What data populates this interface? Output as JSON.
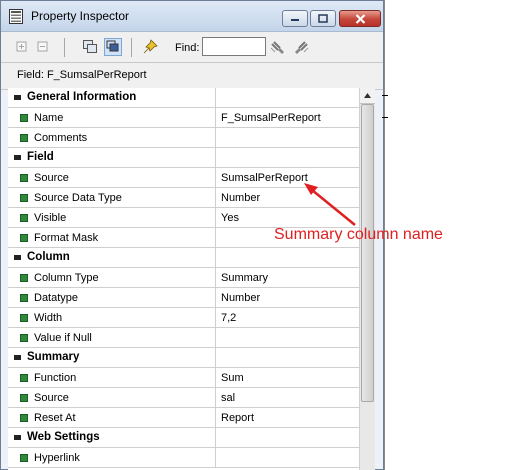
{
  "window": {
    "title": "Property Inspector"
  },
  "toolbar": {
    "find_label": "Find:",
    "find_value": ""
  },
  "field_bar": {
    "text": "Field: F_SumsalPerReport"
  },
  "sections": [
    {
      "label": "General Information",
      "rows": [
        {
          "label": "Name",
          "value": "F_SumsalPerReport"
        },
        {
          "label": "Comments",
          "value": ""
        }
      ]
    },
    {
      "label": "Field",
      "rows": [
        {
          "label": "Source",
          "value": "SumsalPerReport"
        },
        {
          "label": "Source Data Type",
          "value": "Number"
        },
        {
          "label": "Visible",
          "value": "Yes"
        },
        {
          "label": "Format Mask",
          "value": ""
        }
      ]
    },
    {
      "label": "Column",
      "rows": [
        {
          "label": "Column Type",
          "value": "Summary"
        },
        {
          "label": "Datatype",
          "value": "Number"
        },
        {
          "label": "Width",
          "value": "7,2"
        },
        {
          "label": "Value if Null",
          "value": ""
        }
      ]
    },
    {
      "label": "Summary",
      "rows": [
        {
          "label": "Function",
          "value": "Sum"
        },
        {
          "label": "Source",
          "value": "sal"
        },
        {
          "label": "Reset At",
          "value": "Report"
        }
      ]
    },
    {
      "label": "Web Settings",
      "rows": [
        {
          "label": "Hyperlink",
          "value": ""
        }
      ]
    }
  ],
  "annotation": {
    "text": "Summary column name",
    "color": "#e02020"
  },
  "colors": {
    "bullet": "#2f8a3d",
    "close_button": "#c4463a"
  }
}
